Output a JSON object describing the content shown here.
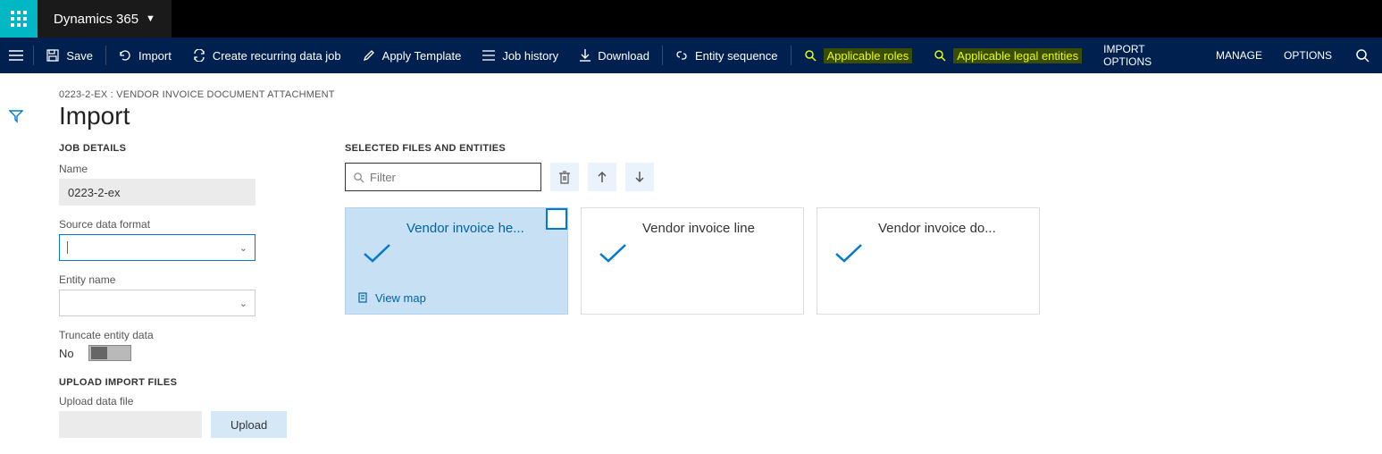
{
  "header": {
    "app_name": "Dynamics 365"
  },
  "actionbar": {
    "save": "Save",
    "import": "Import",
    "create_recurring": "Create recurring data job",
    "apply_template": "Apply Template",
    "job_history": "Job history",
    "download": "Download",
    "entity_sequence": "Entity sequence",
    "applicable_roles": "Applicable roles",
    "applicable_legal_entities": "Applicable legal entities",
    "import_options": "IMPORT OPTIONS",
    "manage": "MANAGE",
    "options": "OPTIONS"
  },
  "page": {
    "breadcrumb": "0223-2-EX : VENDOR INVOICE DOCUMENT ATTACHMENT",
    "title": "Import"
  },
  "jobdetails": {
    "heading": "JOB DETAILS",
    "name_label": "Name",
    "name_value": "0223-2-ex",
    "source_label": "Source data format",
    "source_value": "",
    "entity_label": "Entity name",
    "entity_value": "",
    "truncate_label": "Truncate entity data",
    "truncate_value": "No"
  },
  "upload": {
    "heading": "UPLOAD IMPORT FILES",
    "label": "Upload data file",
    "button": "Upload"
  },
  "entities": {
    "heading": "SELECTED FILES AND ENTITIES",
    "filter_placeholder": "Filter",
    "cards": [
      {
        "title": "Vendor invoice he...",
        "view_map": "View map",
        "selected": true
      },
      {
        "title": "Vendor invoice line",
        "selected": false
      },
      {
        "title": "Vendor invoice do...",
        "selected": false
      }
    ]
  }
}
